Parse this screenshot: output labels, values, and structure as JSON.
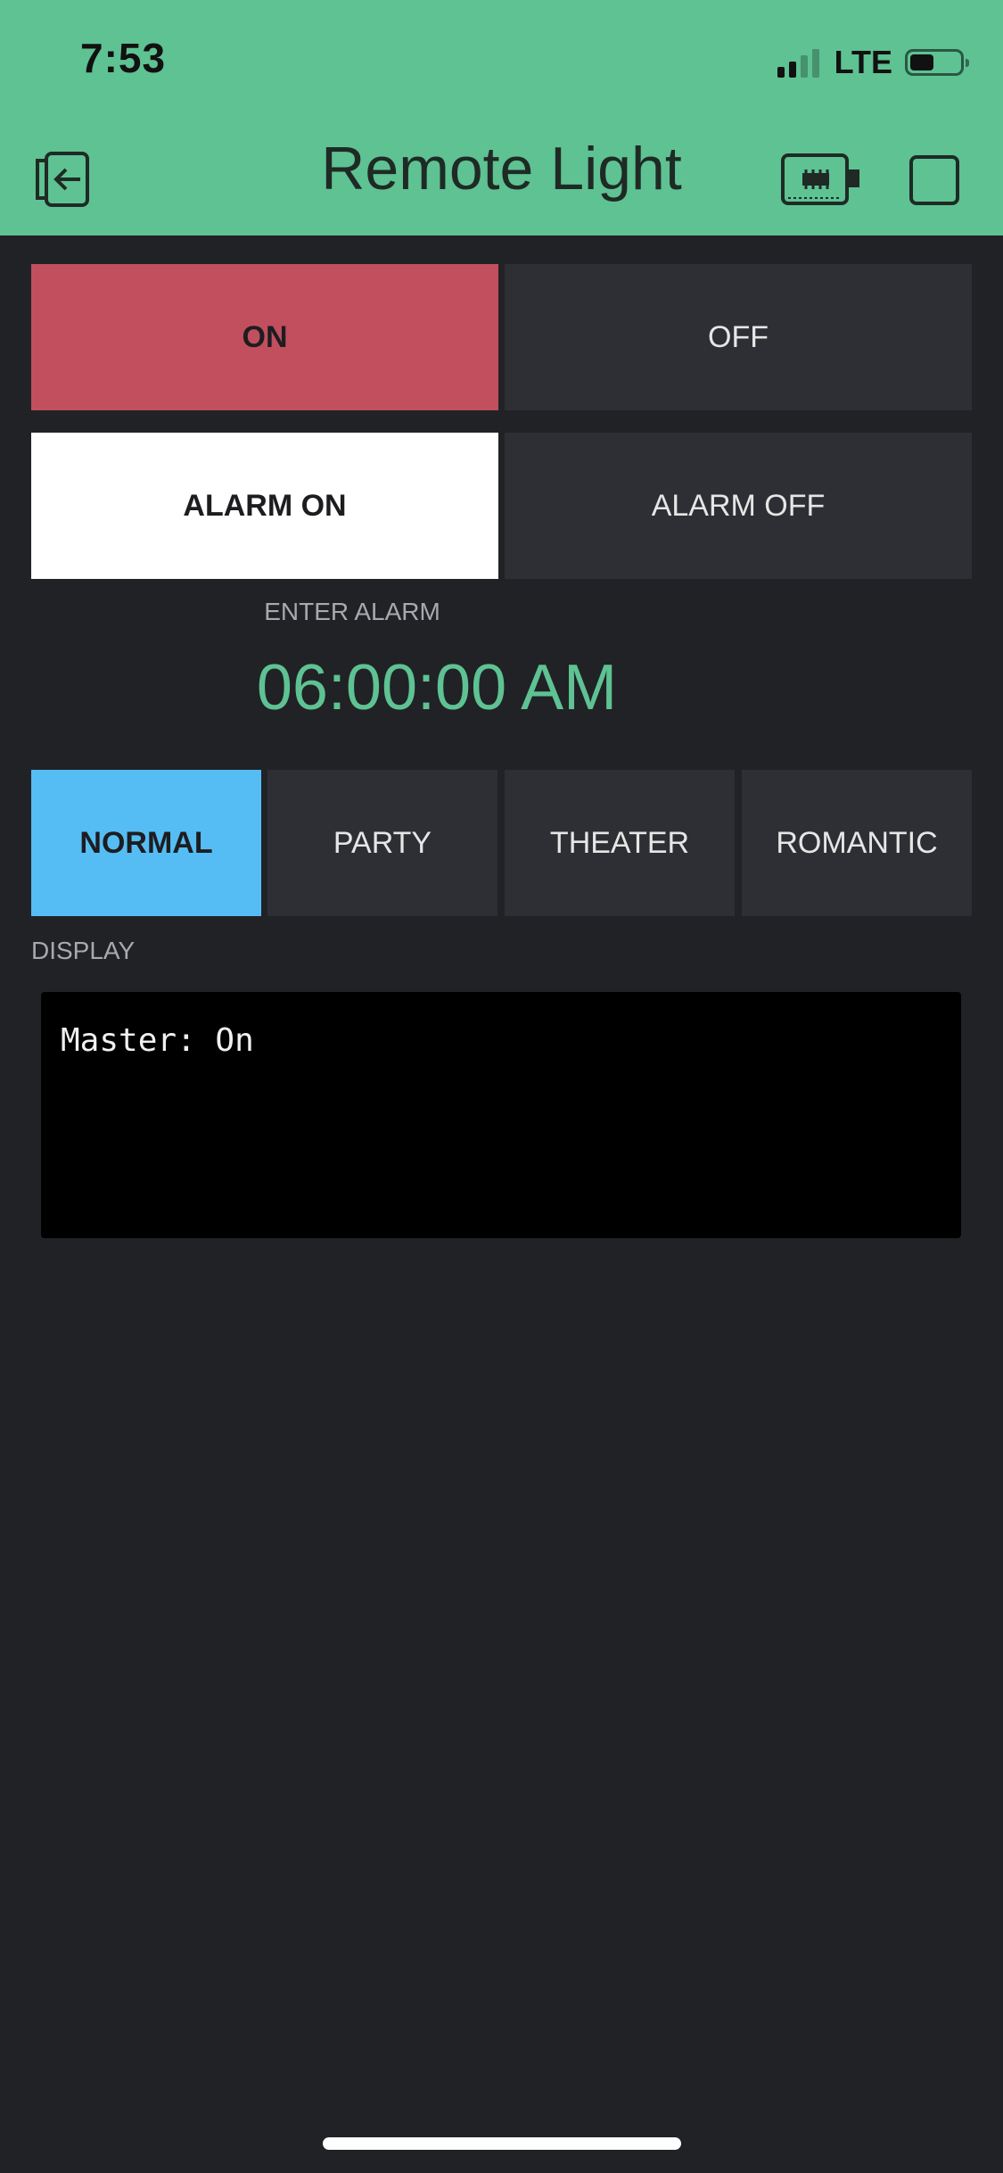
{
  "status_bar": {
    "time": "7:53",
    "network": "LTE",
    "signal_bars_active": 2,
    "signal_bars_total": 4,
    "battery_level": 0.4
  },
  "header": {
    "title": "Remote Light",
    "left_icon": "exit-icon",
    "right_icons": [
      "device-icon",
      "stop-icon"
    ]
  },
  "power": {
    "on_label": "ON",
    "off_label": "OFF",
    "active": "on"
  },
  "alarm": {
    "on_label": "ALARM ON",
    "off_label": "ALARM OFF",
    "active": "on",
    "enter_label": "ENTER ALARM",
    "time_value": "06:00:00 AM"
  },
  "modes": {
    "items": [
      {
        "label": "NORMAL",
        "active": true
      },
      {
        "label": "PARTY",
        "active": false
      },
      {
        "label": "THEATER",
        "active": false
      },
      {
        "label": "ROMANTIC",
        "active": false
      }
    ]
  },
  "display": {
    "label": "DISPLAY",
    "text": "Master: On"
  },
  "colors": {
    "header_green": "#5ec293",
    "background": "#212226",
    "button_idle": "#2e2f35",
    "on_red": "#c14f5e",
    "mode_blue": "#56bdf4",
    "alarm_time_green": "#5ec293"
  }
}
